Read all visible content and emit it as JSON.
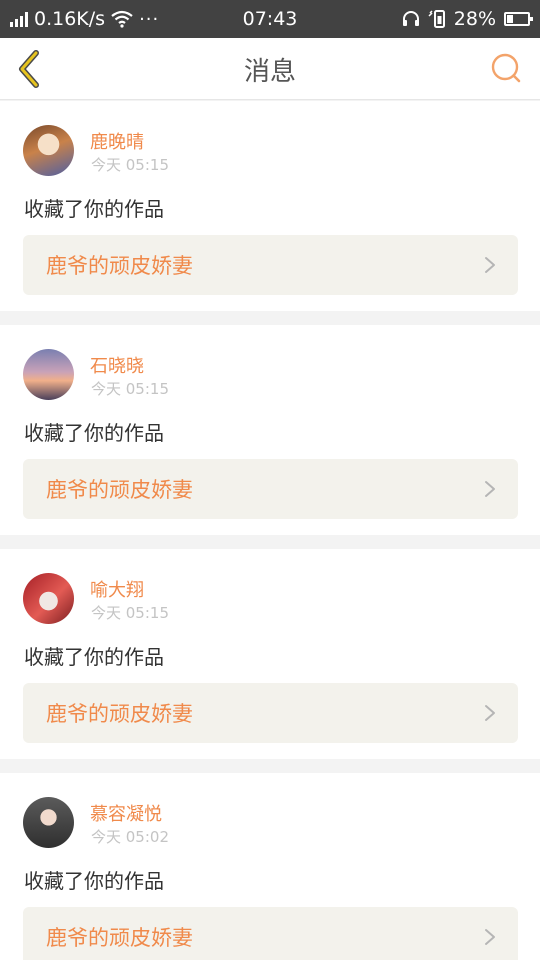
{
  "status_bar": {
    "speed": "0.16K/s",
    "time": "07:43",
    "battery": "28%",
    "more": "···"
  },
  "header": {
    "title": "消息"
  },
  "colors": {
    "accent": "#f08a4b",
    "back_icon": "#e6c31f",
    "search_icon": "#f3a36a"
  },
  "messages": [
    {
      "user": "鹿晚晴",
      "time": "今天 05:15",
      "action": "收藏了你的作品",
      "work": "鹿爷的顽皮娇妻"
    },
    {
      "user": "石晓晓",
      "time": "今天 05:15",
      "action": "收藏了你的作品",
      "work": "鹿爷的顽皮娇妻"
    },
    {
      "user": "喻大翔",
      "time": "今天 05:15",
      "action": "收藏了你的作品",
      "work": "鹿爷的顽皮娇妻"
    },
    {
      "user": "慕容凝悦",
      "time": "今天 05:02",
      "action": "收藏了你的作品",
      "work": "鹿爷的顽皮娇妻"
    }
  ]
}
